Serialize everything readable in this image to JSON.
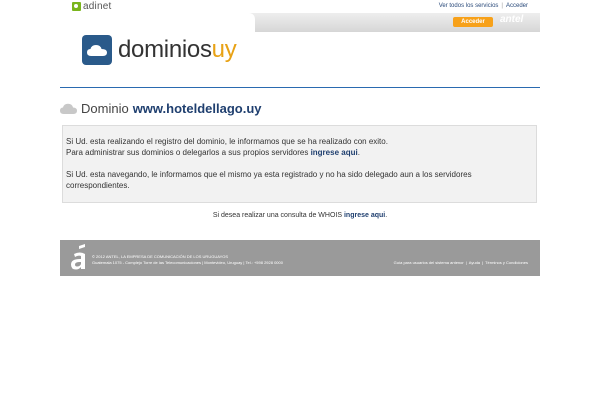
{
  "topbar": {
    "brand": "adinet",
    "links": [
      "Ver todos los servicios",
      "Acceder"
    ],
    "separator": "|"
  },
  "header": {
    "acceder_button": "Acceder",
    "antel_logo": "antel",
    "logo_main": "dominios",
    "logo_accent": "uy"
  },
  "domain": {
    "label": "Dominio",
    "name": "www.hoteldellago.uy"
  },
  "notice": {
    "line1": "Si Ud. esta realizando el registro del dominio, le informamos que se ha realizado con exito.",
    "line2_prefix": "Para administrar sus dominios o delegarlos a sus propios servidores ",
    "line2_link": "ingrese aqui",
    "line2_suffix": ".",
    "line3": "Si Ud. esta navegando, le informamos que el mismo ya esta registrado y no ha sido delegado aun a los servidores correspondientes."
  },
  "whois": {
    "prefix": "Si desea realizar una consulta de WHOIS ",
    "link": "ingrese aqui",
    "suffix": "."
  },
  "footer": {
    "copyright": "© 2012 ANTEL, LA EMPRESA DE COMUNICACIÓN DE LOS URUGUAYOS",
    "address": "Guatemala 1075 - Complejo Torre de las Telecomunicaciones | Montevideo, Uruguay | Tel.: +598 2928 0000",
    "links": [
      "Guía para usuarios del sistema antenor",
      "Ayuda",
      "Términos y Condiciones"
    ],
    "separator": "|"
  },
  "colors": {
    "accent_blue": "#1f3f6f",
    "accent_orange": "#e8a215",
    "button_orange": "#f7a11a",
    "footer_gray": "#9a9a9a"
  }
}
